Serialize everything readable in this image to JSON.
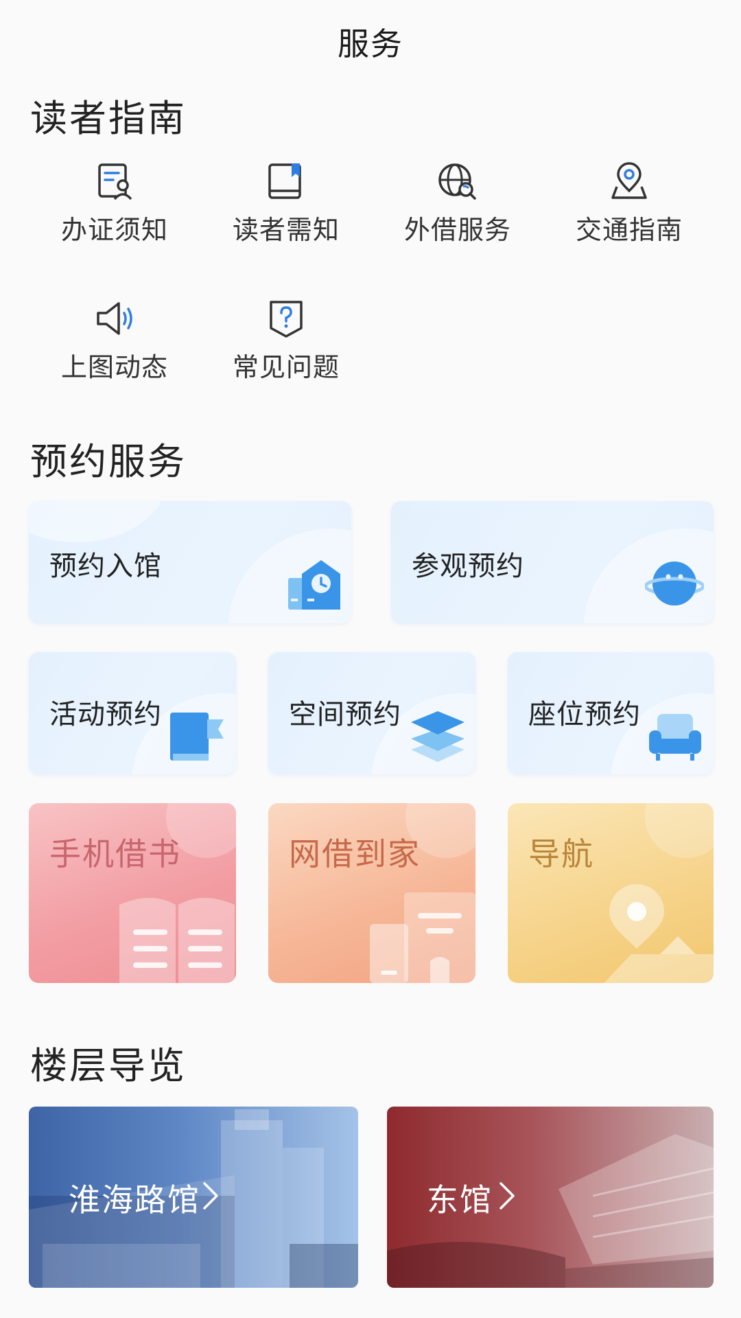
{
  "header": {
    "title": "服务"
  },
  "reader_guide": {
    "title": "读者指南",
    "items": [
      {
        "label": "办证须知",
        "icon": "card-application-icon"
      },
      {
        "label": "读者需知",
        "icon": "book-bookmark-icon"
      },
      {
        "label": "外借服务",
        "icon": "globe-search-icon"
      },
      {
        "label": "交通指南",
        "icon": "location-pin-icon"
      },
      {
        "label": "上图动态",
        "icon": "speaker-icon"
      },
      {
        "label": "常见问题",
        "icon": "question-shield-icon"
      }
    ]
  },
  "booking": {
    "title": "预约服务",
    "cards": [
      {
        "label": "预约入馆",
        "icon": "building-clock-icon"
      },
      {
        "label": "参观预约",
        "icon": "planet-icon"
      },
      {
        "label": "活动预约",
        "icon": "flag-book-icon"
      },
      {
        "label": "空间预约",
        "icon": "layers-icon"
      },
      {
        "label": "座位预约",
        "icon": "sofa-icon"
      }
    ],
    "feature_cards": [
      {
        "label": "手机借书",
        "icon": "open-book-icon",
        "color": "#c8656d"
      },
      {
        "label": "网借到家",
        "icon": "phone-building-icon",
        "color": "#c7684a"
      },
      {
        "label": "导航",
        "icon": "map-pin-icon",
        "color": "#b9853a"
      }
    ]
  },
  "floor_guide": {
    "title": "楼层导览",
    "items": [
      {
        "label": "淮海路馆"
      },
      {
        "label": "东馆"
      }
    ]
  },
  "colors": {
    "accent_blue": "#2f7de1",
    "icon_stroke": "#333333"
  }
}
